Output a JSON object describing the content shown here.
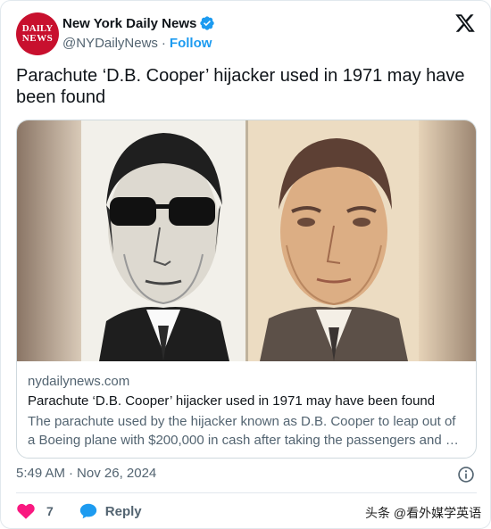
{
  "account": {
    "avatar_text_line1": "DAILY",
    "avatar_text_line2": "NEWS",
    "name": "New York Daily News",
    "handle": "@NYDailyNews",
    "separator": "·",
    "follow_label": "Follow"
  },
  "tweet": {
    "text": "Parachute ‘D.B. Cooper’ hijacker used in 1971 may have been found"
  },
  "link_card": {
    "domain": "nydailynews.com",
    "title": "Parachute ‘D.B. Cooper’ hijacker used in 1971 may have been found",
    "description": "The parachute used by the hijacker known as D.B. Cooper to leap out of a Boeing plane with $200,000 in cash after taking the passengers and …"
  },
  "meta": {
    "time": "5:49 AM",
    "separator": "·",
    "date": "Nov 26, 2024"
  },
  "actions": {
    "like_count": "7",
    "reply_label": "Reply"
  },
  "watermark": "头条 @看外媒学英语",
  "colors": {
    "brand_blue": "#1d9bf0",
    "like_pink": "#f91880",
    "avatar_red": "#c8102e",
    "muted_text": "#536471"
  },
  "icons": [
    "verified-badge-icon",
    "x-logo-icon",
    "info-icon",
    "heart-icon",
    "reply-bubble-icon"
  ]
}
